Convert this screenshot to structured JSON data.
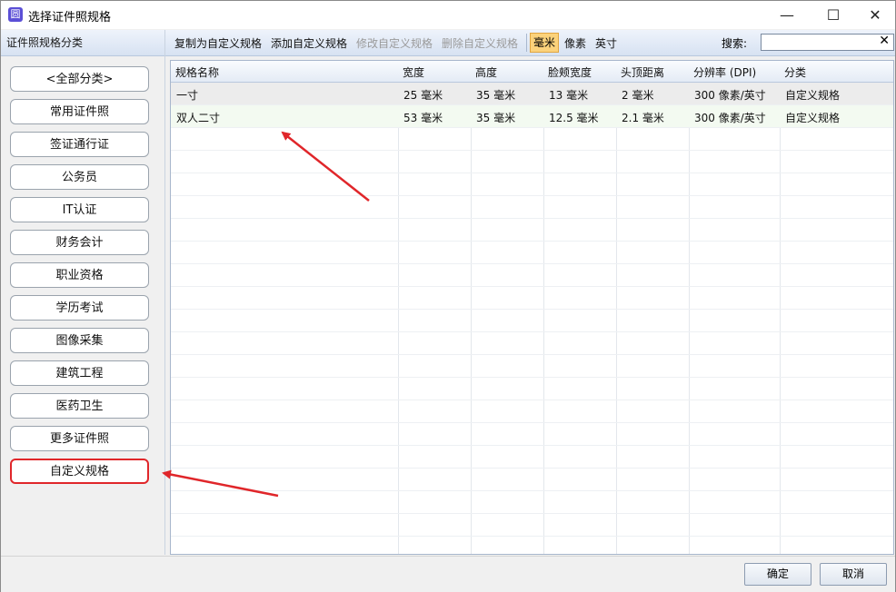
{
  "window": {
    "title": "选择证件照规格",
    "icon_label": "圆"
  },
  "left_panel": {
    "header": "证件照规格分类",
    "categories": [
      "<全部分类>",
      "常用证件照",
      "签证通行证",
      "公务员",
      "IT认证",
      "财务会计",
      "职业资格",
      "学历考试",
      "图像采集",
      "建筑工程",
      "医药卫生",
      "更多证件照",
      "自定义规格"
    ],
    "active_index": 12
  },
  "toolbar": {
    "copy_label": "复制为自定义规格",
    "add_label": "添加自定义规格",
    "edit_label": "修改自定义规格",
    "delete_label": "删除自定义规格",
    "unit_mm": "毫米",
    "unit_px": "像素",
    "unit_inch": "英寸",
    "search_label": "搜索:",
    "search_value": "",
    "clear_symbol": "✕"
  },
  "table": {
    "headers": [
      "规格名称",
      "宽度",
      "高度",
      "脸颊宽度",
      "头顶距离",
      "分辨率 (DPI)",
      "分类"
    ],
    "rows": [
      [
        "一寸",
        "25 毫米",
        "35 毫米",
        "13 毫米",
        "2 毫米",
        "300 像素/英寸",
        "自定义规格"
      ],
      [
        "双人二寸",
        "53 毫米",
        "35 毫米",
        "12.5 毫米",
        "2.1 毫米",
        "300 像素/英寸",
        "自定义规格"
      ]
    ]
  },
  "footer": {
    "ok_label": "确定",
    "cancel_label": "取消"
  },
  "colors": {
    "annotation_red": "#e0262a",
    "unit_highlight": "#fbd27b"
  }
}
